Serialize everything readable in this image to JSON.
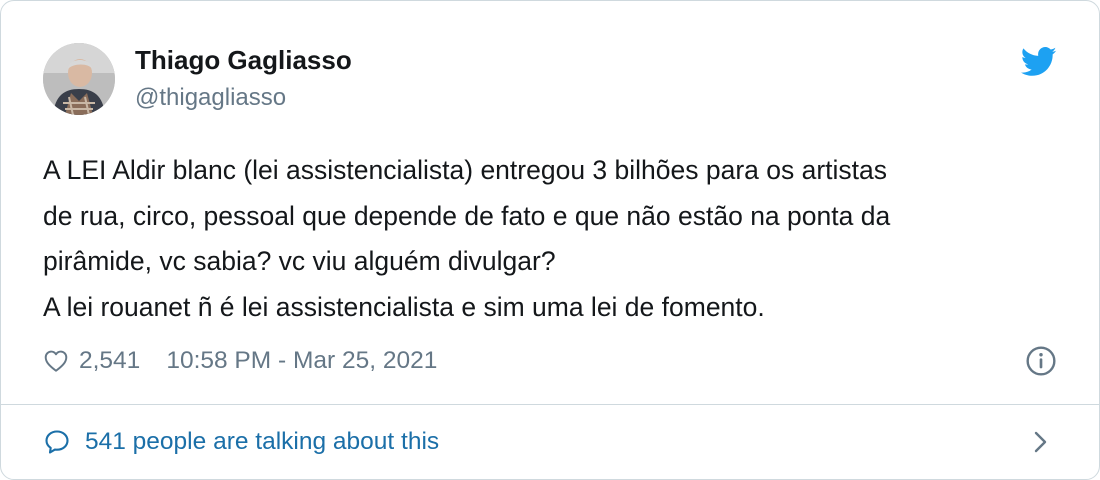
{
  "author": {
    "name": "Thiago Gagliasso",
    "handle": "@thigagliasso",
    "avatar_icon": "profile-photo"
  },
  "brand": {
    "icon": "twitter-bird-icon",
    "color": "#1da1f2"
  },
  "tweet": {
    "lines": [
      "A LEI Aldir blanc (lei assistencialista) entregou 3 bilhões para os artistas",
      "de rua, circo, pessoal que depende de fato e que não estão na ponta da",
      "pirâmide, vc sabia? vc viu alguém divulgar?",
      "A lei rouanet ñ é lei assistencialista e sim uma lei de fomento."
    ]
  },
  "meta": {
    "likes": "2,541",
    "timestamp": "10:58 PM - Mar 25, 2021",
    "like_icon": "heart-outline-icon",
    "info_icon": "info-circle-icon"
  },
  "footer": {
    "talking_label": "541 people are talking about this",
    "talking_icon": "speech-bubble-icon",
    "chevron_icon": "chevron-right-icon",
    "link_color": "#1b6fa8"
  },
  "colors": {
    "text": "#14171a",
    "muted": "#657786",
    "border": "#cfd9de"
  }
}
